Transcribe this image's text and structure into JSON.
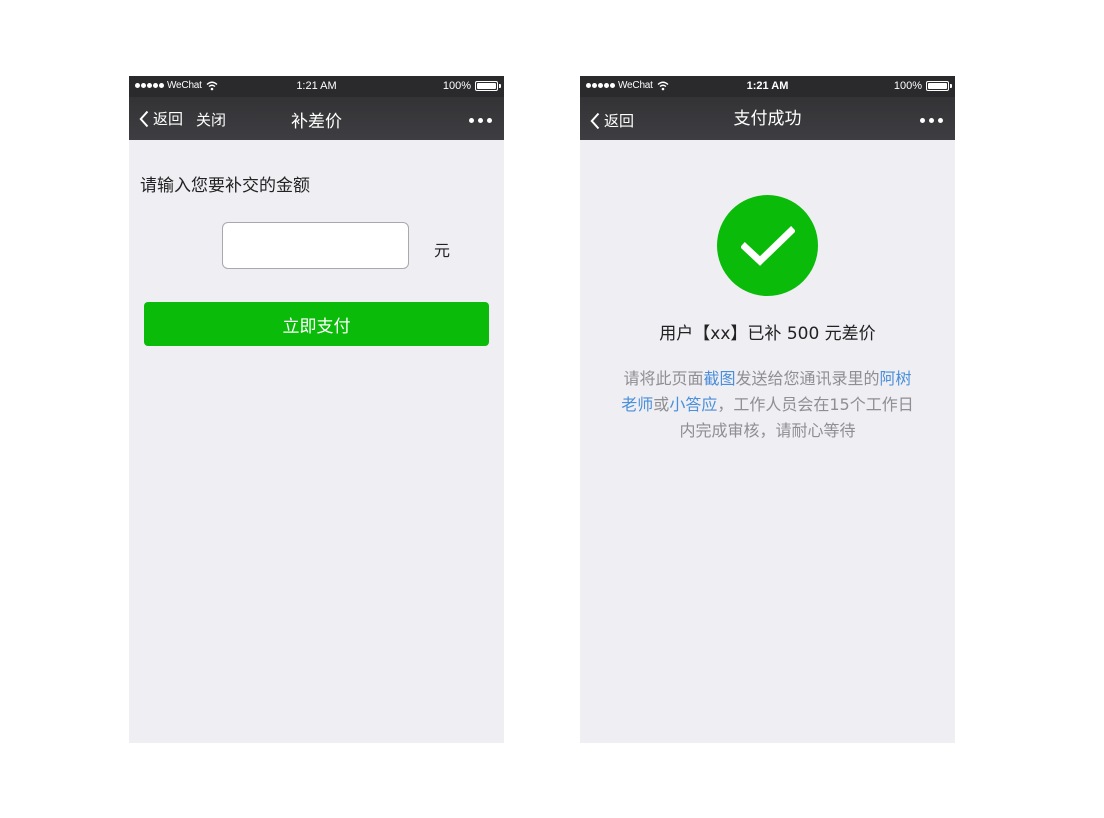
{
  "colors": {
    "accent_green": "#0bbb0a",
    "nav_bg": "#3a3a3d",
    "page_bg": "#eeeef3",
    "link_blue": "#4a8fd9",
    "muted_text": "#8e8e93"
  },
  "left_screen": {
    "status_bar": {
      "carrier": "WeChat",
      "time": "1:21 AM",
      "battery": "100%"
    },
    "nav": {
      "back_label": "返回",
      "close_label": "关闭",
      "title": "补差价",
      "more_icon": "more-dots-icon"
    },
    "prompt": "请输入您要补交的金额",
    "amount_input": {
      "value": "",
      "placeholder": ""
    },
    "unit": "元",
    "pay_button": "立即支付"
  },
  "right_screen": {
    "status_bar": {
      "carrier": "WeChat",
      "time": "1:21 AM",
      "battery": "100%"
    },
    "nav": {
      "back_label": "返回",
      "title": "支付成功",
      "more_icon": "more-dots-icon"
    },
    "success_icon": "checkmark-icon",
    "success_message": "用户【xx】已补 500 元差价",
    "instructions": {
      "part1": "请将此页面",
      "link1": "截图",
      "part2": "发送给您通讯录里的",
      "link2": "阿树老师",
      "part3": "或",
      "link3": "小答应",
      "part4": "，工作人员会在15个工作日内完成审核，请耐心等待"
    }
  }
}
